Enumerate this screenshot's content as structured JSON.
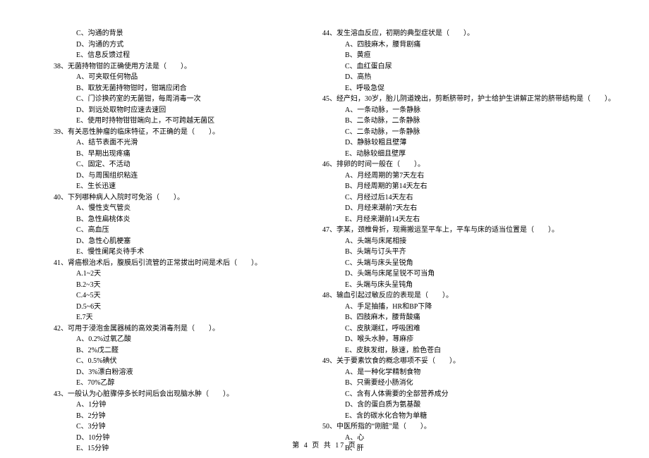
{
  "left": {
    "trailing_options": [
      "C、沟通的背景",
      "D、沟通的方式",
      "E、信息反馈过程"
    ],
    "questions": [
      {
        "num": "38、",
        "stem": "无菌持物钳的正确使用方法是（　　）。",
        "options": [
          "A、可夹取任何物品",
          "B、取放无菌持物钳时，钳端应闭合",
          "C、门诊换药室的无菌钳，每周消毒一次",
          "D、到远处取物时应速去速回",
          "E、使用时持物钳钳端向上，不可跨越无菌区"
        ]
      },
      {
        "num": "39、",
        "stem": "有关恶性肿瘤的临床特征，不正确的是（　　）。",
        "options": [
          "A、结节表面不光滑",
          "B、早期出现疼痛",
          "C、固定、不活动",
          "D、与周围组织粘连",
          "E、生长迅速"
        ]
      },
      {
        "num": "40、",
        "stem": "下列哪种病人入院时可免浴（　　）。",
        "options": [
          "A、慢性支气管炎",
          "B、急性扁桃体炎",
          "C、高血压",
          "D、急性心肌梗塞",
          "E、慢性阑尾炎待手术"
        ]
      },
      {
        "num": "41、",
        "stem": "肾癌根治术后，腹膜后引流管的正常拔出时间是术后（　　）。",
        "options": [
          "A.1~2天",
          "B.2~3天",
          "C.4~5天",
          "D.5~6天",
          "E.7天"
        ]
      },
      {
        "num": "42、",
        "stem": "可用于浸泡金属器械的高效类消毒剂是（　　）。",
        "options": [
          "A、0.2%过氧乙酸",
          "B、2%戊二醛",
          "C、0.5%碘伏",
          "D、3%漂白粉溶液",
          "E、70%乙醇"
        ]
      },
      {
        "num": "43、",
        "stem": "一般认为心脏骤停多长时间后会出现脑水肿（　　）。",
        "options": [
          "A、1分钟",
          "B、2分钟",
          "C、3分钟",
          "D、10分钟",
          "E、15分钟"
        ]
      }
    ]
  },
  "right": {
    "questions": [
      {
        "num": "44、",
        "stem": "发生溶血反应，初期的典型症状是（　　）。",
        "options": [
          "A、四肢麻木，腰背剧痛",
          "B、黄疸",
          "C、血红蛋白尿",
          "D、高热",
          "E、呼吸急促"
        ]
      },
      {
        "num": "45、",
        "stem": "经产妇，30岁，胎儿阴道娩出，剪断脐带时，护士给护生讲解正常的脐带结构是（　　）。",
        "options": [
          "A、一条动脉，一条静脉",
          "B、二条动脉，二条静脉",
          "C、二条动脉，一条静脉",
          "D、静脉较粗且壁薄",
          "E、动脉较细且壁厚"
        ]
      },
      {
        "num": "46、",
        "stem": "排卵的时间一般在（　　）。",
        "options": [
          "A、月经周期的第7天左右",
          "B、月经周期的第14天左右",
          "C、月经过后14天左右",
          "D、月经来潮前7天左右",
          "E、月经来潮前14天左右"
        ]
      },
      {
        "num": "47、",
        "stem": "李某，颈椎骨折，现需搬运至平车上，平车与床的适当位置是（　　）。",
        "options": [
          "A、头端与床尾相接",
          "B、头端与订头平齐",
          "C、头端与床头呈锐角",
          "D、头端与床尾呈锐不可当角",
          "E、头端与床头呈钝角"
        ]
      },
      {
        "num": "48、",
        "stem": "输血引起过敏反应的表现是（　　）。",
        "options": [
          "A、手足抽搐，HR和BP下降",
          "B、四肢麻木，腰背酸痛",
          "C、皮肤潮红，呼吸困难",
          "D、喉头水肿，荨麻疹",
          "E、皮肤发绀，脉速，脸色苍白"
        ]
      },
      {
        "num": "49、",
        "stem": "关于要素饮食的概念哪项不妥（　　）。",
        "options": [
          "A、是一种化学精制食物",
          "B、只需要经小肠消化",
          "C、含有人体需要的全部营养成分",
          "D、含的蛋白质为氨基酸",
          "E、含的碳水化合物为单糖"
        ]
      },
      {
        "num": "50、",
        "stem": "中医所指的“刚脏”是（　　）。",
        "options": [
          "A、心",
          "B、肝"
        ]
      }
    ]
  },
  "footer": "第 4 页 共 17 页"
}
